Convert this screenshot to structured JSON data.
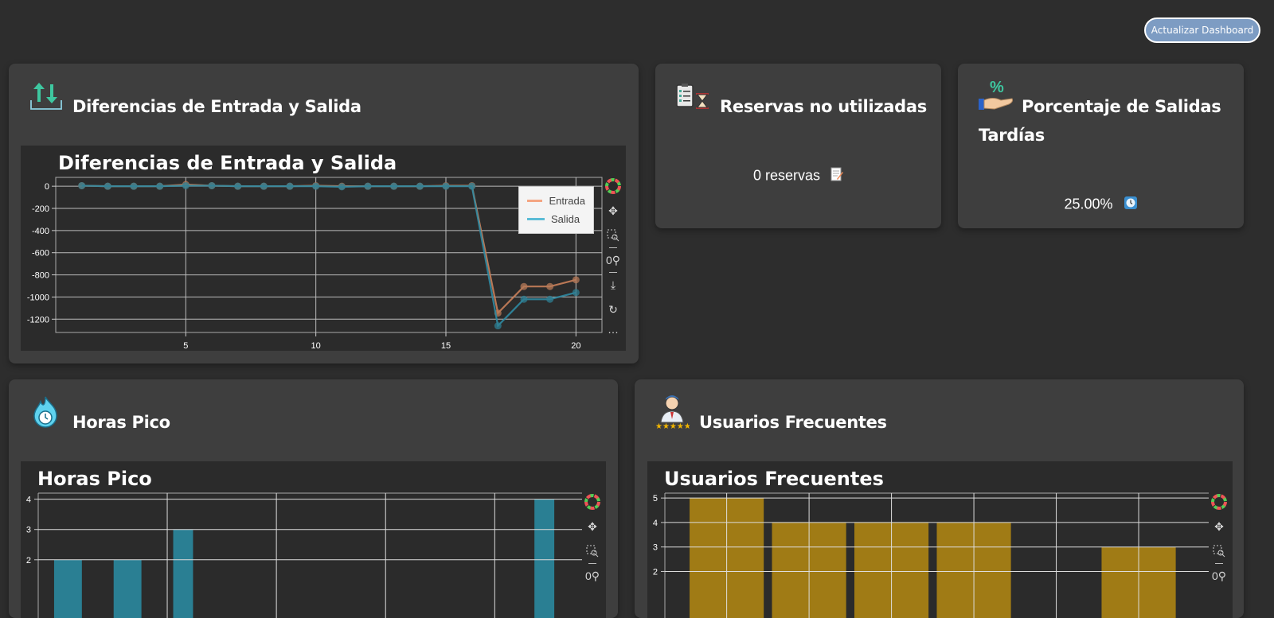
{
  "header": {
    "refresh_label": "Actualizar Dashboard"
  },
  "cards": {
    "differences": {
      "title": "Diferencias de Entrada y Salida",
      "icon": "arrows-up-down-icon"
    },
    "unused": {
      "title": "Reservas no utilizadas",
      "value": "0 reservas",
      "icon": "clipboard-hourglass-icon",
      "value_icon": "memo-icon"
    },
    "late": {
      "title_line1": "Porcentaje de Salidas",
      "title_line2": "Tardías",
      "value": "25.00%",
      "icon": "percent-hand-icon",
      "value_icon": "clock-icon"
    },
    "peak": {
      "title": "Horas Pico",
      "icon": "clock-flame-icon"
    },
    "frequent": {
      "title": "Usuarios Frecuentes",
      "icon": "star-user-icon"
    }
  },
  "toolbar": {
    "icons": [
      "bokeh-logo-icon",
      "pan-icon",
      "box-zoom-icon",
      "wheel-zoom-icon",
      "save-icon",
      "reset-icon",
      "more-icon"
    ]
  },
  "colors": {
    "entrada": "#f4a582",
    "salida": "#5bbcd6",
    "bar_blue": "#2a7f93",
    "bar_gold": "#a07b15",
    "card": "#3e3e3e",
    "page": "#2d2d2d"
  },
  "chart_data": [
    {
      "type": "line",
      "title": "Diferencias de Entrada y Salida",
      "x": [
        1,
        2,
        3,
        4,
        5,
        6,
        7,
        8,
        9,
        10,
        11,
        12,
        13,
        14,
        15,
        16,
        17,
        18,
        19,
        20
      ],
      "series": [
        {
          "name": "Entrada",
          "values": [
            5,
            0,
            0,
            0,
            15,
            5,
            0,
            0,
            0,
            5,
            0,
            0,
            0,
            0,
            5,
            5,
            -1145,
            -905,
            -905,
            -845
          ]
        },
        {
          "name": "Salida",
          "values": [
            5,
            0,
            0,
            0,
            5,
            5,
            0,
            0,
            0,
            0,
            -5,
            0,
            0,
            0,
            0,
            0,
            -1260,
            -1020,
            -1020,
            -960
          ]
        }
      ],
      "xticks": [
        5,
        10,
        15,
        20
      ],
      "yticks": [
        0,
        -200,
        -400,
        -600,
        -800,
        -1000,
        -1200
      ],
      "xlim": [
        0,
        21
      ],
      "ylim": [
        -1320,
        80
      ],
      "grid": true,
      "legend": "top-right"
    },
    {
      "type": "bar",
      "title": "Horas Pico",
      "bars": [
        {
          "x0": 0.8,
          "x1": 2.2,
          "v": 2
        },
        {
          "x0": 3.8,
          "x1": 5.2,
          "v": 2
        },
        {
          "x0": 6.8,
          "x1": 7.8,
          "v": 3
        },
        {
          "x0": 25,
          "x1": 26,
          "v": 4
        }
      ],
      "xgrid": [
        6.5,
        12,
        17.5,
        23
      ],
      "yticks": [
        2,
        3,
        4
      ],
      "xlim": [
        0,
        27.4
      ],
      "ylim": [
        0,
        4.2
      ],
      "grid": true
    },
    {
      "type": "bar",
      "title": "Usuarios Frecuentes",
      "bars": [
        {
          "x0": 0.3,
          "x1": 1.2,
          "v": 5
        },
        {
          "x0": 1.3,
          "x1": 2.2,
          "v": 4
        },
        {
          "x0": 2.3,
          "x1": 3.2,
          "v": 4
        },
        {
          "x0": 3.3,
          "x1": 4.2,
          "v": 4
        },
        {
          "x0": 5.3,
          "x1": 6.2,
          "v": 3
        }
      ],
      "xgrid": [
        0.75,
        1.75,
        2.75,
        3.75,
        4.75,
        5.75
      ],
      "yticks": [
        2,
        3,
        4,
        5
      ],
      "xlim": [
        0,
        6.6
      ],
      "ylim": [
        0,
        5.2
      ],
      "grid": true
    }
  ]
}
